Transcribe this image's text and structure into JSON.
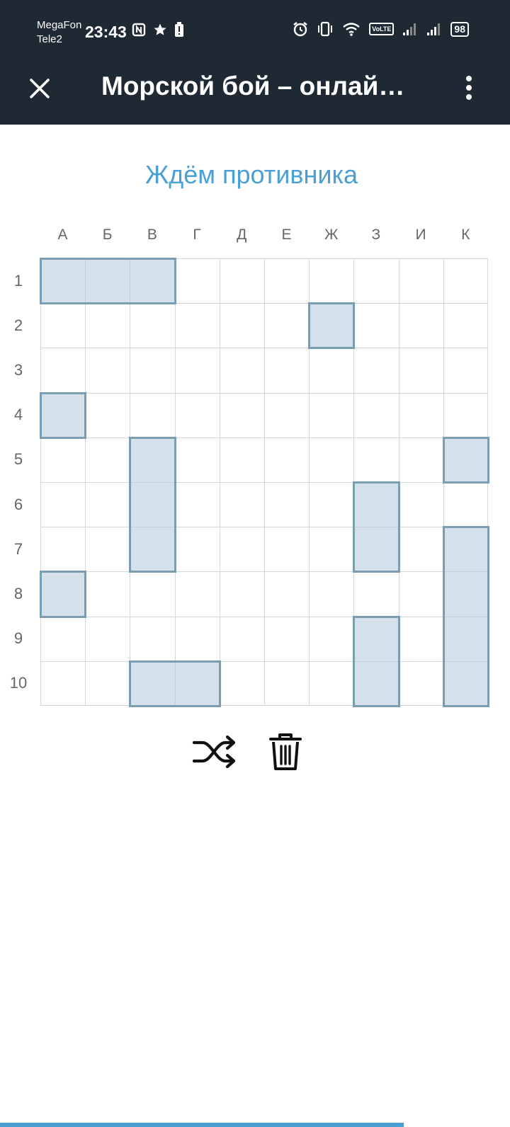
{
  "status_bar": {
    "carrier_1": "MegaFon",
    "carrier_2": "Tele2",
    "time": "23:43",
    "volte": "VoLTE",
    "battery": "98"
  },
  "header": {
    "title": "Морской бой – онлай…",
    "close_icon": "close-icon",
    "menu_icon": "more-vert-icon"
  },
  "game": {
    "status": "Ждём противника",
    "columns": [
      "А",
      "Б",
      "В",
      "Г",
      "Д",
      "Е",
      "Ж",
      "З",
      "И",
      "К"
    ],
    "rows": [
      "1",
      "2",
      "3",
      "4",
      "5",
      "6",
      "7",
      "8",
      "9",
      "10"
    ],
    "grid_size": 10,
    "ships": [
      {
        "start": "А1",
        "cells": 3,
        "orientation": "horizontal",
        "col": 0,
        "row": 0
      },
      {
        "start": "Ж2",
        "cells": 1,
        "orientation": "horizontal",
        "col": 6,
        "row": 1
      },
      {
        "start": "А4",
        "cells": 1,
        "orientation": "horizontal",
        "col": 0,
        "row": 3
      },
      {
        "start": "В5",
        "cells": 3,
        "orientation": "vertical",
        "col": 2,
        "row": 4
      },
      {
        "start": "К5",
        "cells": 1,
        "orientation": "horizontal",
        "col": 9,
        "row": 4
      },
      {
        "start": "З6",
        "cells": 2,
        "orientation": "vertical",
        "col": 7,
        "row": 5
      },
      {
        "start": "К7",
        "cells": 4,
        "orientation": "vertical",
        "col": 9,
        "row": 6
      },
      {
        "start": "А8",
        "cells": 1,
        "orientation": "horizontal",
        "col": 0,
        "row": 7
      },
      {
        "start": "З9",
        "cells": 2,
        "orientation": "vertical",
        "col": 7,
        "row": 8
      },
      {
        "start": "В10",
        "cells": 2,
        "orientation": "horizontal",
        "col": 2,
        "row": 9
      }
    ],
    "colors": {
      "ship_fill": "#b7cdde",
      "ship_border": "#7a9db2",
      "heading": "#4a9fd4",
      "header_bg": "#1f2933"
    }
  },
  "actions": {
    "shuffle_icon": "shuffle-icon",
    "trash_icon": "trash-icon"
  }
}
